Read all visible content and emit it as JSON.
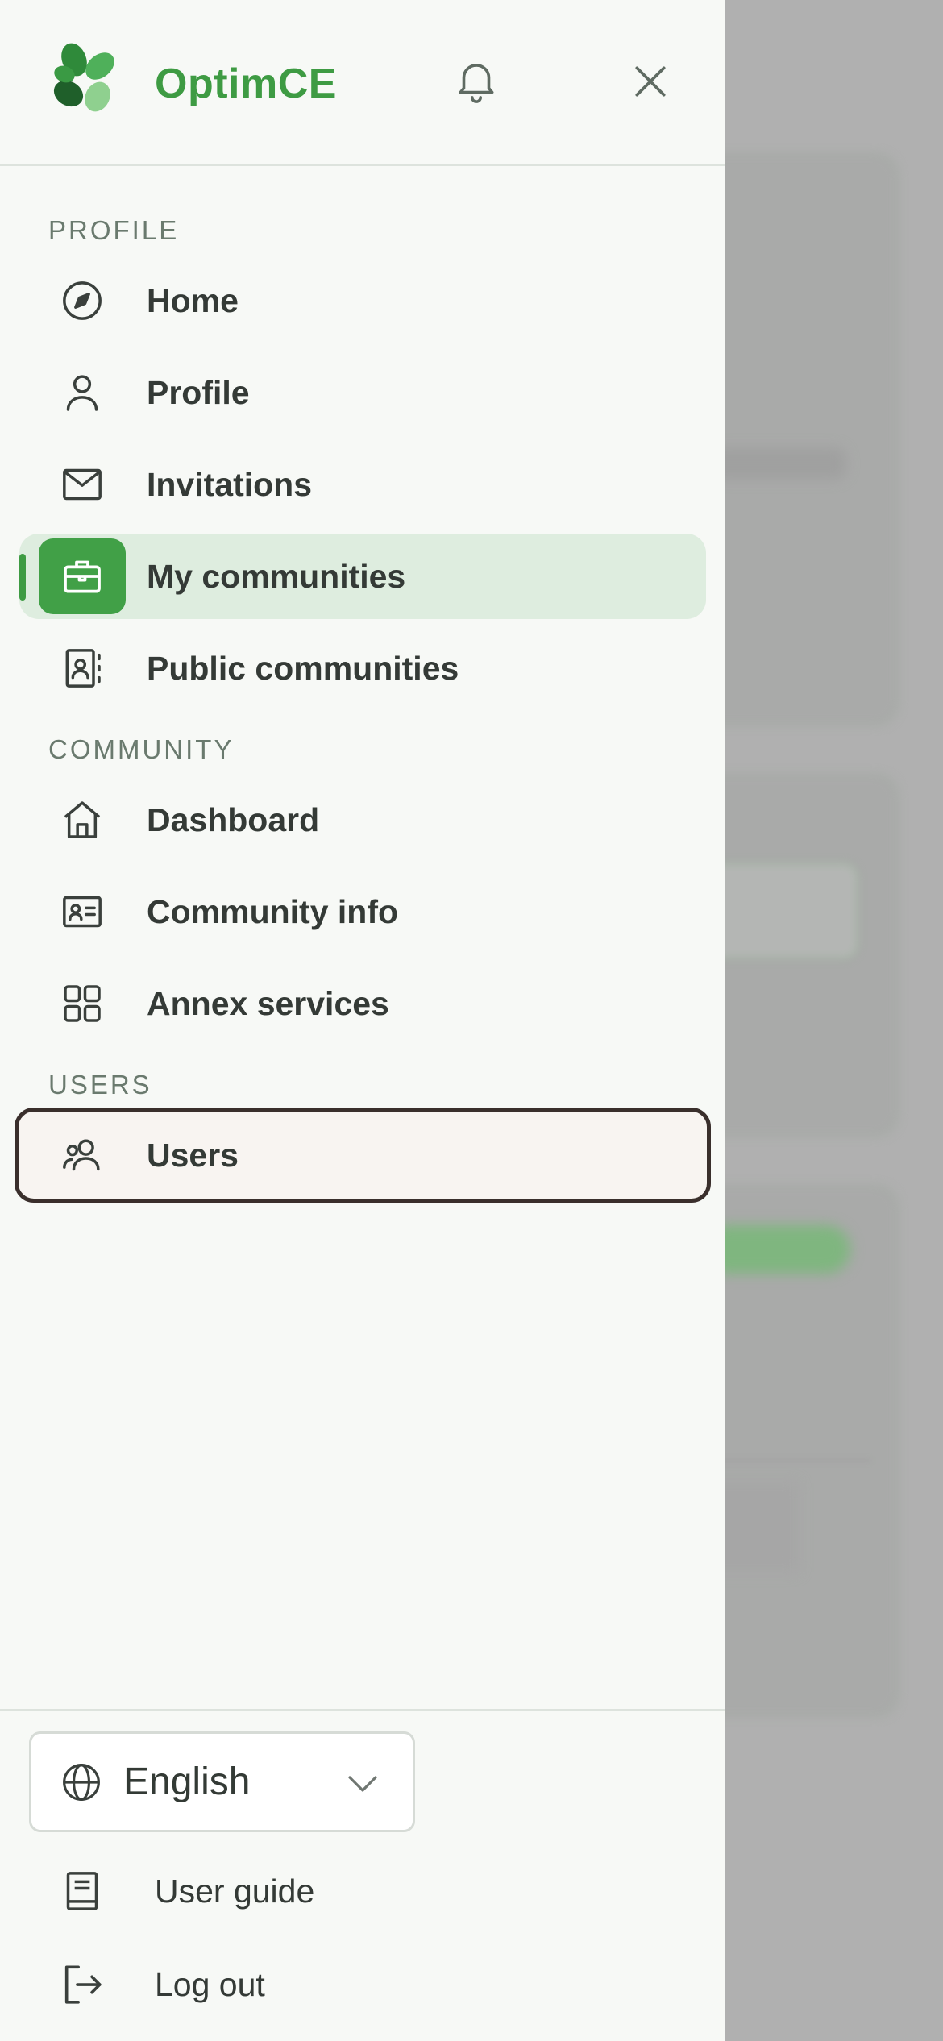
{
  "app": {
    "brand": "OptimCE"
  },
  "colors": {
    "accent": "#3e9b43",
    "active_bg": "#deeddf",
    "focus_border": "#3a2f2c"
  },
  "sections": {
    "profile": {
      "title": "PROFILE",
      "items": [
        {
          "label": "Home",
          "icon": "compass-icon"
        },
        {
          "label": "Profile",
          "icon": "user-icon"
        },
        {
          "label": "Invitations",
          "icon": "envelope-icon"
        },
        {
          "label": "My communities",
          "icon": "briefcase-icon",
          "active": true
        },
        {
          "label": "Public communities",
          "icon": "contact-book-icon"
        }
      ]
    },
    "community": {
      "title": "COMMUNITY",
      "items": [
        {
          "label": "Dashboard",
          "icon": "home-icon"
        },
        {
          "label": "Community info",
          "icon": "id-card-icon"
        },
        {
          "label": "Annex services",
          "icon": "grid-icon"
        }
      ]
    },
    "users": {
      "title": "USERS",
      "items": [
        {
          "label": "Users",
          "icon": "users-icon",
          "focused": true
        }
      ]
    }
  },
  "footer": {
    "language": {
      "selected": "English",
      "icon": "globe-icon"
    },
    "user_guide": {
      "label": "User guide",
      "icon": "book-icon"
    },
    "logout": {
      "label": "Log out",
      "icon": "logout-icon"
    }
  }
}
